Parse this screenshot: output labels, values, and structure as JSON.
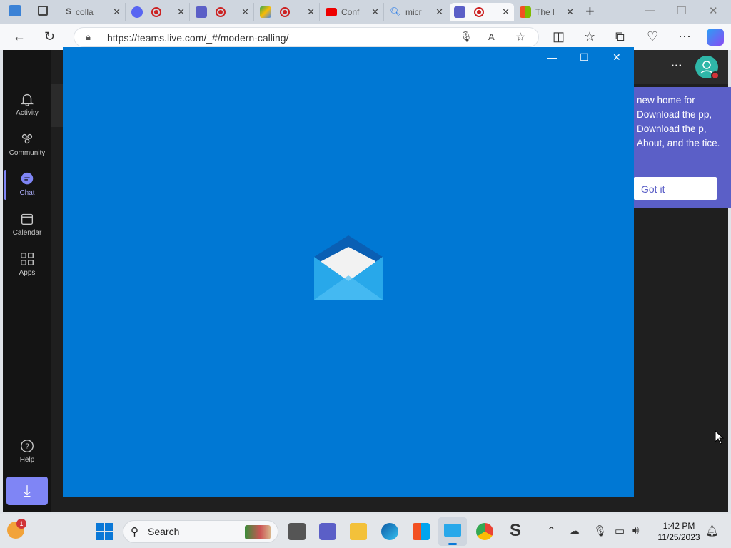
{
  "browser": {
    "tabs": [
      {
        "title": "colla",
        "favicon": "S"
      },
      {
        "title": "",
        "favicon": "discord"
      },
      {
        "title": "",
        "favicon": "teams"
      },
      {
        "title": "",
        "favicon": "google-drive"
      },
      {
        "title": "Conf",
        "favicon": "youtube"
      },
      {
        "title": "micr",
        "favicon": "search"
      },
      {
        "title": "",
        "favicon": "teams"
      },
      {
        "title": "The l",
        "favicon": "microsoft"
      }
    ],
    "url": "https://teams.live.com/_#/modern-calling/"
  },
  "teams": {
    "rail": [
      {
        "label": "Activity",
        "icon": "bell-icon"
      },
      {
        "label": "Community",
        "icon": "community-icon"
      },
      {
        "label": "Chat",
        "icon": "chat-icon"
      },
      {
        "label": "Calendar",
        "icon": "calendar-icon"
      },
      {
        "label": "Apps",
        "icon": "apps-icon"
      },
      {
        "label": "Help",
        "icon": "help-icon"
      }
    ],
    "popup": {
      "text": "new home for Download the pp, Download the p, About, and the tice.",
      "button": "Got it"
    }
  },
  "taskbar": {
    "search": "Search",
    "time": "1:42 PM",
    "date": "11/25/2023",
    "notification_badge": "1"
  },
  "colors": {
    "splash": "#0078d4",
    "teams_accent": "#5b5fc7",
    "rail_bg": "#141414"
  }
}
